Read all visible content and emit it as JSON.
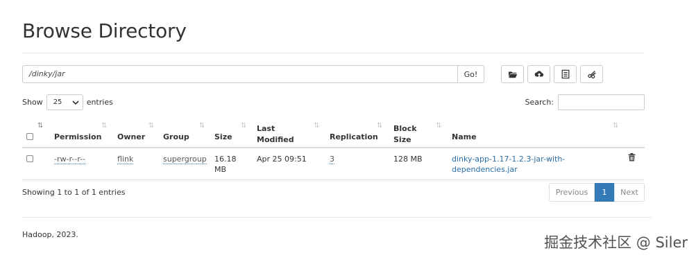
{
  "page": {
    "title": "Browse Directory"
  },
  "pathbar": {
    "path": "/dinky/jar",
    "go_label": "Go!"
  },
  "toolbar": {
    "icons": [
      "folder-open-icon",
      "upload-cloud-icon",
      "list-icon",
      "cut-icon"
    ]
  },
  "controls": {
    "show_label": "Show",
    "page_size": "25",
    "entries_label": "entries",
    "search_label": "Search:"
  },
  "table": {
    "columns": [
      "Permission",
      "Owner",
      "Group",
      "Size",
      "Last Modified",
      "Replication",
      "Block Size",
      "Name"
    ],
    "columns_split": {
      "last_modified": [
        "Last",
        "Modified"
      ],
      "block_size": [
        "Block",
        "Size"
      ]
    },
    "rows": [
      {
        "permission": "-rw-r--r--",
        "owner": "flink",
        "group": "supergroup",
        "size_line1": "16.18",
        "size_line2": "MB",
        "last_modified": "Apr 25 09:51",
        "replication": "3",
        "block_size": "128 MB",
        "name_line1": "dinky-app-1.17-1.2.3-jar-with-",
        "name_line2": "dependencies.jar"
      }
    ]
  },
  "info": {
    "text": "Showing 1 to 1 of 1 entries"
  },
  "pagination": {
    "previous": "Previous",
    "current": "1",
    "next": "Next"
  },
  "footer": {
    "text": "Hadoop, 2023."
  },
  "watermark": {
    "text": "掘金技术社区 @ Siler"
  },
  "colors": {
    "accent": "#337ab7",
    "link": "#2a6ea8"
  }
}
